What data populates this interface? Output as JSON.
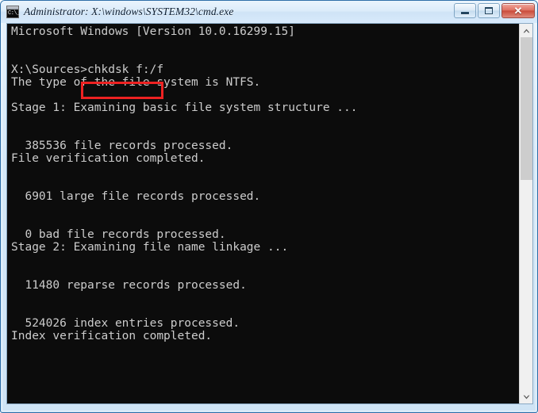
{
  "window": {
    "title": "Administrator: X:\\windows\\SYSTEM32\\cmd.exe",
    "icon_prompt": "C:\\_",
    "background_color": "#0c0c0c",
    "text_color": "#cccccc",
    "frame_color": "#cfe4f5"
  },
  "titlebar_buttons": {
    "minimize_label": "",
    "maximize_label": "",
    "close_label": "✕"
  },
  "annotation": {
    "highlight_color": "#ee2222",
    "highlighted_text": "chkdsk f:/f"
  },
  "console": {
    "lines": [
      "Microsoft Windows [Version 10.0.16299.15]",
      "",
      "",
      "X:\\Sources>chkdsk f:/f",
      "The type of the file system is NTFS.",
      "",
      "Stage 1: Examining basic file system structure ...",
      "",
      "",
      "  385536 file records processed.",
      "File verification completed.",
      "",
      "",
      "  6901 large file records processed.",
      "",
      "",
      "  0 bad file records processed.",
      "Stage 2: Examining file name linkage ...",
      "",
      "",
      "  11480 reparse records processed.",
      "",
      "",
      "  524026 index entries processed.",
      "Index verification completed.",
      "",
      ""
    ],
    "prompt": "X:\\Sources>",
    "command": "chkdsk f:/f",
    "version_line": "Microsoft Windows [Version 10.0.16299.15]",
    "filesystem": "NTFS",
    "stats": {
      "file_records_processed": "385536",
      "large_file_records_processed": "6901",
      "bad_file_records_processed": "0",
      "reparse_records_processed": "11480",
      "index_entries_processed": "524026"
    }
  },
  "scrollbar": {
    "up_arrow": "▲",
    "down_arrow": "▼",
    "thumb_position_percent": 0,
    "thumb_size_percent": 9
  }
}
